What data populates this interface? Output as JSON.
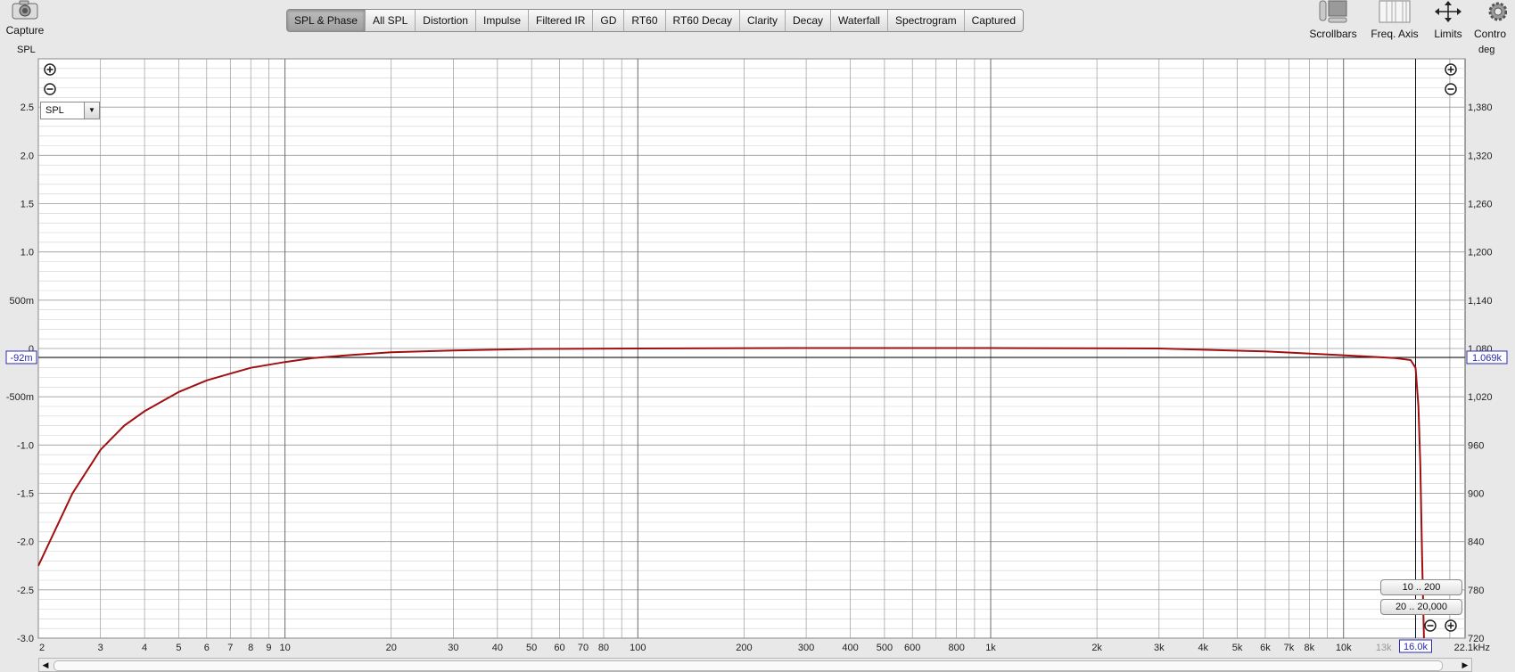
{
  "toolbar": {
    "capture_label": "Capture",
    "tabs": [
      "SPL & Phase",
      "All SPL",
      "Distortion",
      "Impulse",
      "Filtered IR",
      "GD",
      "RT60",
      "RT60 Decay",
      "Clarity",
      "Decay",
      "Waterfall",
      "Spectrogram",
      "Captured"
    ],
    "active_tab": "SPL & Phase",
    "scrollbars_label": "Scrollbars",
    "freq_axis_label": "Freq. Axis",
    "limits_label": "Limits",
    "controls_label": "Contro"
  },
  "plot": {
    "left_unit": "SPL",
    "right_unit": "deg",
    "select_value": "SPL",
    "cursor_left_value": "-92m",
    "cursor_right_value": "1.069k",
    "cursor_freq_value": "16.0k",
    "range_buttons": [
      "10 .. 200",
      "20 .. 20,000"
    ],
    "colors": {
      "curve": "#a01010",
      "grid_major": "#9a9a9a",
      "grid_minor": "#cfcfcf",
      "axis_box": "#2a2ab0"
    }
  },
  "chart_data": {
    "type": "line",
    "xscale": "log",
    "xlim": [
      2,
      22100
    ],
    "ylim": [
      -3.0,
      3.0
    ],
    "y2lim": [
      720,
      1440
    ],
    "x_ticks": [
      "2",
      "3",
      "4",
      "5",
      "6",
      "7",
      "8",
      "9",
      "10",
      "20",
      "30",
      "40",
      "50",
      "60",
      "70",
      "80",
      "100",
      "200",
      "300",
      "400",
      "500",
      "600",
      "800",
      "1k",
      "2k",
      "3k",
      "4k",
      "5k",
      "6k",
      "7k",
      "8k",
      "10k",
      "13k",
      "16.0k",
      "22.1kHz"
    ],
    "y_ticks": [
      "2.5",
      "2.0",
      "1.5",
      "1.0",
      "500m",
      "0",
      "-500m",
      "-1.0",
      "-1.5",
      "-2.0",
      "-2.5",
      "-3.0"
    ],
    "y2_ticks": [
      "1,380",
      "1,320",
      "1,260",
      "1,200",
      "1,140",
      "1,080",
      "1,020",
      "960",
      "900",
      "840",
      "780",
      "720"
    ],
    "cursor": {
      "freq": 16000,
      "spl": -0.092
    },
    "series": [
      {
        "x": [
          2,
          2.5,
          3,
          3.5,
          4,
          5,
          6,
          7,
          8,
          10,
          12,
          15,
          20,
          30,
          50,
          100,
          300,
          1000,
          3000,
          6000,
          10000,
          14000,
          15500,
          16000,
          16300,
          16500,
          16700,
          16900
        ],
        "y": [
          -2.25,
          -1.5,
          -1.05,
          -0.8,
          -0.65,
          -0.45,
          -0.33,
          -0.26,
          -0.2,
          -0.14,
          -0.1,
          -0.07,
          -0.04,
          -0.02,
          -0.005,
          0,
          0.005,
          0.005,
          0,
          -0.03,
          -0.07,
          -0.1,
          -0.12,
          -0.2,
          -0.6,
          -1.2,
          -2.2,
          -3.0
        ]
      }
    ]
  }
}
